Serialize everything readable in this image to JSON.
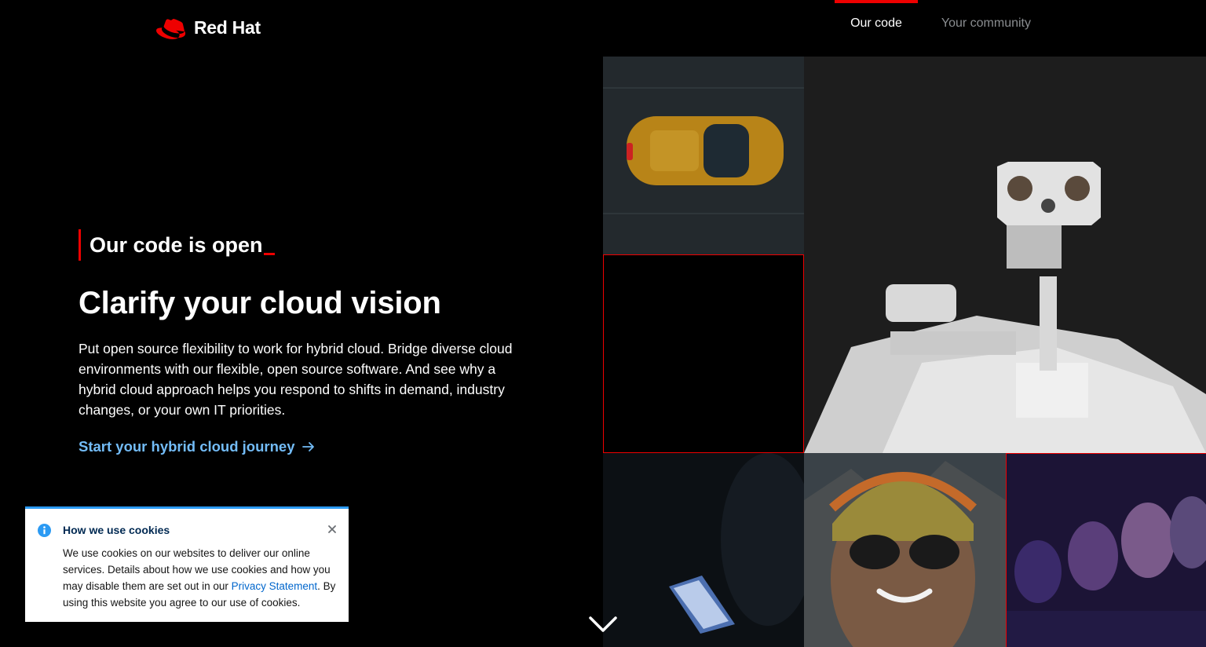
{
  "brand": {
    "name": "Red Hat",
    "logo_color": "#ee0000"
  },
  "nav": {
    "items": [
      {
        "label": "Our code",
        "active": true
      },
      {
        "label": "Your community",
        "active": false
      }
    ]
  },
  "hero": {
    "kicker": "Our code is open",
    "headline": "Clarify your cloud vision",
    "body": "Put open source flexibility to work for hybrid cloud. Bridge diverse cloud environments with our flexible, open source software. And see why a hybrid cloud approach helps you respond to shifts in demand, industry changes, or your own IT priorities.",
    "cta_label": "Start your hybrid cloud journey"
  },
  "mosaic": {
    "tiles": [
      "car-photo",
      "robot-photo",
      "empty-tile",
      "phone-photo",
      "hiker-photo",
      "audience-photo"
    ]
  },
  "cookie_banner": {
    "title": "How we use cookies",
    "text_before_link": "We use cookies on our websites to deliver our online services. Details about how we use cookies and how you may disable them are set out in our ",
    "link_label": "Privacy Statement",
    "text_after_link": ". By using this website you agree to our use of cookies."
  },
  "colors": {
    "accent": "#ee0000",
    "link": "#73bcf7",
    "info": "#2b9af3",
    "background": "#000000"
  }
}
